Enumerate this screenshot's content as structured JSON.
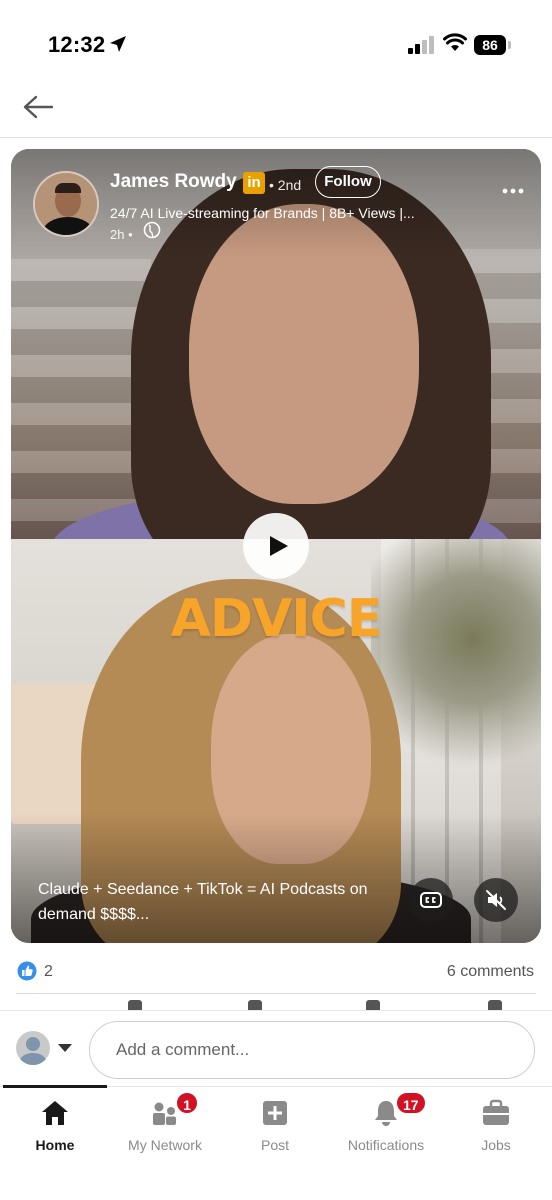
{
  "status_bar": {
    "time": "12:32",
    "battery": "86"
  },
  "header": {
    "back_icon": "arrow-left-icon"
  },
  "post": {
    "author": {
      "name": "James Rowdy",
      "badge": "in",
      "degree": "• 2nd",
      "headline": "24/7 AI Live-streaming for Brands | 8B+ Views |...",
      "time": "2h •"
    },
    "follow_label": "Follow",
    "video": {
      "overlay_text": "ADVICE",
      "caption": "Claude + Seedance + TikTok = AI Podcasts on demand $$$$...",
      "accent_color": "#f7a52a"
    },
    "reactions": {
      "count": "2"
    },
    "comments_count": "6 comments"
  },
  "comment_bar": {
    "placeholder": "Add a comment..."
  },
  "nav": {
    "items": [
      {
        "label": "Home",
        "icon": "home-icon",
        "badge": ""
      },
      {
        "label": "My Network",
        "icon": "network-icon",
        "badge": "1"
      },
      {
        "label": "Post",
        "icon": "post-icon",
        "badge": ""
      },
      {
        "label": "Notifications",
        "icon": "bell-icon",
        "badge": "17"
      },
      {
        "label": "Jobs",
        "icon": "briefcase-icon",
        "badge": ""
      }
    ]
  },
  "colors": {
    "brand": "#0a66c2",
    "badge": "#d11124",
    "linkedin_badge": "#e9a100"
  }
}
